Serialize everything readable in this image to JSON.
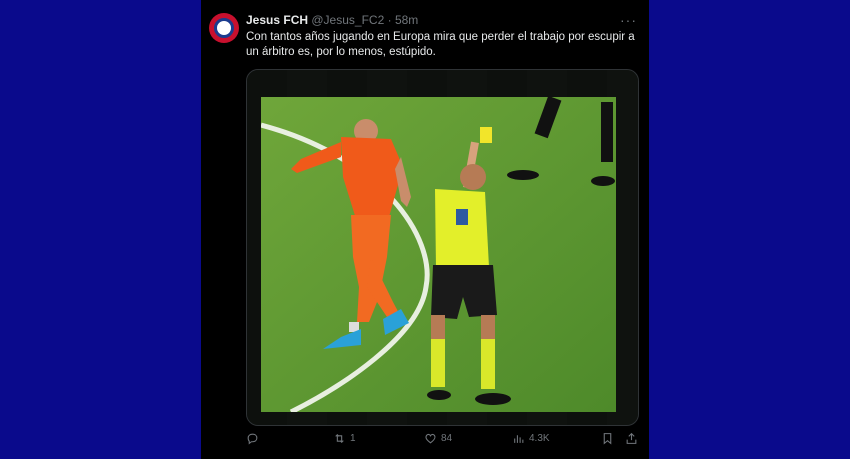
{
  "tweet": {
    "display_name": "Jesus FCH",
    "handle": "@Jesus_FC2",
    "separator": "·",
    "time": "58m",
    "text": "Con tantos años jugando en Europa mira que perder el trabajo por escupir a un árbitro es, por lo menos, estúpido."
  },
  "actions": {
    "reply_count": "",
    "retweet_count": "1",
    "like_count": "84",
    "view_count": "4.3K"
  },
  "icons": [
    "more-icon",
    "reply-icon",
    "retweet-icon",
    "like-icon",
    "views-icon",
    "bookmark-icon",
    "share-icon"
  ]
}
